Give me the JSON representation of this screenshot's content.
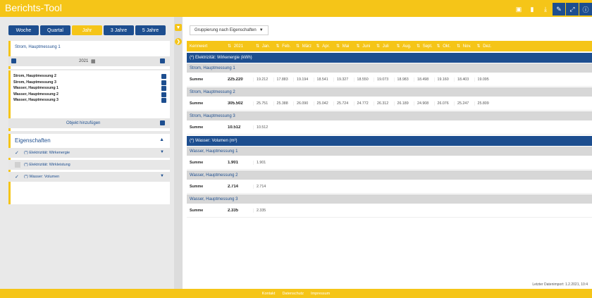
{
  "app": {
    "title": "Berichts-Tool"
  },
  "toolbar": {
    "icons": [
      "bin-icon",
      "bookmark-icon",
      "download-icon",
      "edit-icon",
      "expand-icon",
      "info-icon"
    ]
  },
  "periods": [
    {
      "label": "Woche",
      "active": false
    },
    {
      "label": "Quartal",
      "active": false
    },
    {
      "label": "Jahr",
      "active": true
    },
    {
      "label": "3 Jahre",
      "active": false
    },
    {
      "label": "5 Jahre",
      "active": false
    }
  ],
  "selection": {
    "label": "Strom, Hauptmessung 1",
    "year": "2021"
  },
  "objects": {
    "items": [
      "Strom, Hauptmessung 2",
      "Strom, Hauptmessung 3",
      "Wasser, Hauptmessung 1",
      "Wasser, Hauptmessung 2",
      "Wasser, Hauptmessung 3"
    ],
    "add_label": "Objekt hinzufügen"
  },
  "properties": {
    "title": "Eigenschaften",
    "items": [
      {
        "label": "(*) Elektrizität: Wirkenergie",
        "checked": true
      },
      {
        "label": "(*) Elektrizität: Wirkleistung",
        "checked": false
      },
      {
        "label": "(*) Wasser: Volumen",
        "checked": true
      }
    ]
  },
  "grouping": {
    "label": "Gruppierung nach Eigenschaften"
  },
  "table": {
    "headers": [
      "Kennwert",
      "2021",
      "Jan.",
      "Feb.",
      "März",
      "Apr.",
      "Mai",
      "Juni",
      "Juli",
      "Aug.",
      "Sept.",
      "Okt.",
      "Nov.",
      "Dez."
    ],
    "sections": [
      {
        "title": "(*) Elektrizität: Wirkenergie (kWh)",
        "objects": [
          {
            "name": "Strom, Hauptmessung 1",
            "row": {
              "label": "Summe",
              "total": "225.220",
              "months": [
                "19.212",
                "17.883",
                "19.194",
                "18.541",
                "19.327",
                "18.550",
                "19.073",
                "18.983",
                "18.498",
                "19.160",
                "18.403",
                "19.095"
              ]
            }
          },
          {
            "name": "Strom, Hauptmessung 2",
            "row": {
              "label": "Summe",
              "total": "305.502",
              "months": [
                "25.751",
                "25.388",
                "26.090",
                "25.042",
                "25.724",
                "24.772",
                "26.312",
                "26.189",
                "24.908",
                "26.076",
                "25.247",
                "25.809"
              ]
            }
          },
          {
            "name": "Strom, Hauptmessung 3",
            "row": {
              "label": "Summe",
              "total": "10.512",
              "months": [
                "10.512"
              ]
            }
          }
        ]
      },
      {
        "title": "(*) Wasser: Volumen (m³)",
        "objects": [
          {
            "name": "Wasser, Hauptmessung 1",
            "row": {
              "label": "Summe",
              "total": "1.901",
              "months": [
                "1.901"
              ]
            }
          },
          {
            "name": "Wasser, Hauptmessung 2",
            "row": {
              "label": "Summe",
              "total": "2.714",
              "months": [
                "2.714"
              ]
            }
          },
          {
            "name": "Wasser, Hauptmessung 3",
            "row": {
              "label": "Summe",
              "total": "2.335",
              "months": [
                "2.335"
              ]
            }
          }
        ]
      }
    ]
  },
  "status": {
    "last_import": "Letzter Datenimport: 1.2.2021, 10:4"
  },
  "footer": {
    "links": [
      "Kontakt",
      "Datenschutz",
      "Impressum"
    ]
  }
}
